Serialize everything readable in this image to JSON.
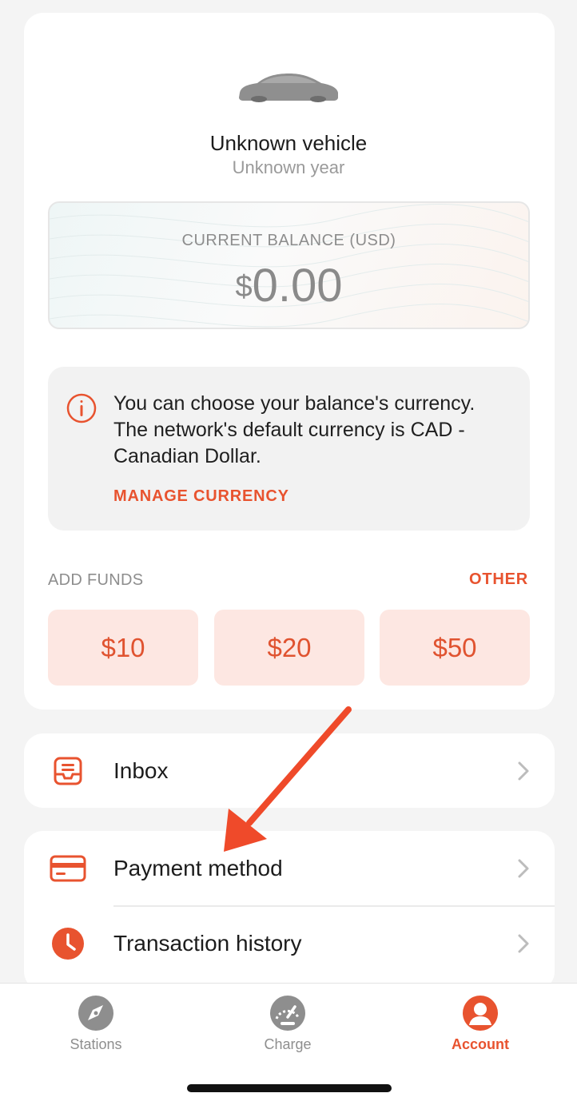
{
  "vehicle": {
    "name": "Unknown vehicle",
    "year": "Unknown year"
  },
  "balance": {
    "label": "CURRENT BALANCE (USD)",
    "currency_symbol": "$",
    "amount": "0.00"
  },
  "currency_notice": {
    "text": "You can choose your balance's currency. The network's default currency is CAD - Canadian Dollar.",
    "link_label": "MANAGE CURRENCY"
  },
  "add_funds": {
    "label": "ADD FUNDS",
    "other_label": "OTHER",
    "amounts": [
      "$10",
      "$20",
      "$50"
    ]
  },
  "menu": {
    "inbox": "Inbox",
    "payment_method": "Payment method",
    "transaction_history": "Transaction history"
  },
  "tabs": [
    {
      "label": "Stations",
      "icon": "compass-icon",
      "active": false
    },
    {
      "label": "Charge",
      "icon": "gauge-icon",
      "active": false
    },
    {
      "label": "Account",
      "icon": "user-icon",
      "active": true
    }
  ],
  "colors": {
    "accent": "#e8532f",
    "fund_button_bg": "#fde7e2",
    "inactive_tab": "#8e8e8e"
  }
}
